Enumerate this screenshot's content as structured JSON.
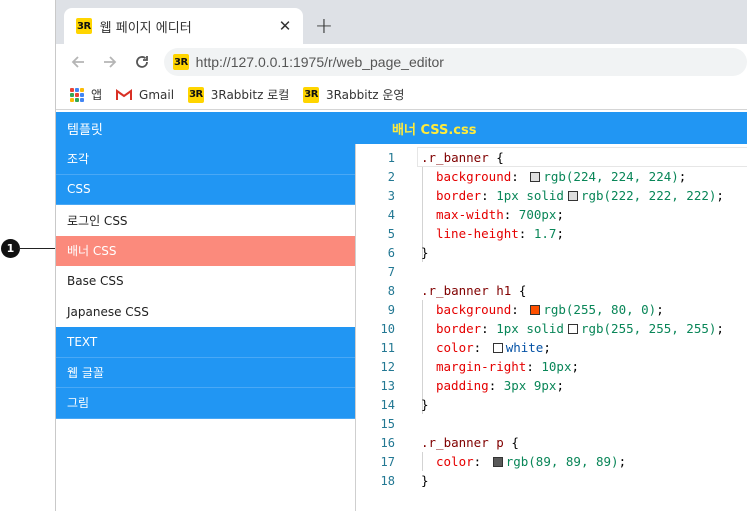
{
  "callout": {
    "number": "1"
  },
  "browser": {
    "tab_title": "웹 페이지 에디터",
    "close_symbol": "✕",
    "new_tab_symbol": "+",
    "logo_text": "3R",
    "url": "http://127.0.0.1:1975/r/web_page_editor",
    "bookmarks": [
      {
        "label": "앱",
        "icon": "apps-grid-icon"
      },
      {
        "label": "Gmail",
        "icon": "gmail-icon"
      },
      {
        "label": "3Rabbitz 로컬",
        "icon": "3r-logo-icon"
      },
      {
        "label": "3Rabbitz 운영",
        "icon": "3r-logo-icon"
      }
    ]
  },
  "app": {
    "header_left": "템플릿",
    "file_title": "배너 CSS.css",
    "accent_color": "#2196f3",
    "selected_color": "#fb8a7c"
  },
  "sidebar": {
    "items": [
      {
        "label": "조각",
        "kind": "category"
      },
      {
        "label": "CSS",
        "kind": "category"
      },
      {
        "label": "로그인 CSS",
        "kind": "file"
      },
      {
        "label": "배너 CSS",
        "kind": "selected"
      },
      {
        "label": "Base CSS",
        "kind": "file"
      },
      {
        "label": "Japanese CSS",
        "kind": "file"
      },
      {
        "label": "TEXT",
        "kind": "category"
      },
      {
        "label": "웹 글꼴",
        "kind": "category"
      },
      {
        "label": "그림",
        "kind": "category"
      }
    ]
  },
  "editor": {
    "lines": [
      {
        "n": "1",
        "selector": ".r_banner",
        "brace": " {"
      },
      {
        "n": "2",
        "prop": "background",
        "swatch": "#e0e0e0",
        "value": "rgb(224, 224, 224)"
      },
      {
        "n": "3",
        "prop": "border",
        "pre": "1px solid",
        "swatch": "#dedede",
        "value": "rgb(222, 222, 222)"
      },
      {
        "n": "4",
        "prop": "max-width",
        "value": "700px"
      },
      {
        "n": "5",
        "prop": "line-height",
        "value": "1.7"
      },
      {
        "n": "6",
        "close": "}"
      },
      {
        "n": "7"
      },
      {
        "n": "8",
        "selector": ".r_banner h1",
        "brace": " {"
      },
      {
        "n": "9",
        "prop": "background",
        "swatch": "#ff5000",
        "value": "rgb(255, 80, 0)"
      },
      {
        "n": "10",
        "prop": "border",
        "pre": "1px solid",
        "swatch": "#ffffff",
        "value": "rgb(255, 255, 255)"
      },
      {
        "n": "11",
        "prop": "color",
        "swatch": "#ffffff",
        "value": "white",
        "keyword": true
      },
      {
        "n": "12",
        "prop": "margin-right",
        "value": "10px"
      },
      {
        "n": "13",
        "prop": "padding",
        "value": "3px 9px"
      },
      {
        "n": "14",
        "close": "}"
      },
      {
        "n": "15"
      },
      {
        "n": "16",
        "selector": ".r_banner p",
        "brace": " {"
      },
      {
        "n": "17",
        "prop": "color",
        "swatch": "#595959",
        "value": "rgb(89, 89, 89)"
      },
      {
        "n": "18",
        "close": "}"
      }
    ]
  }
}
